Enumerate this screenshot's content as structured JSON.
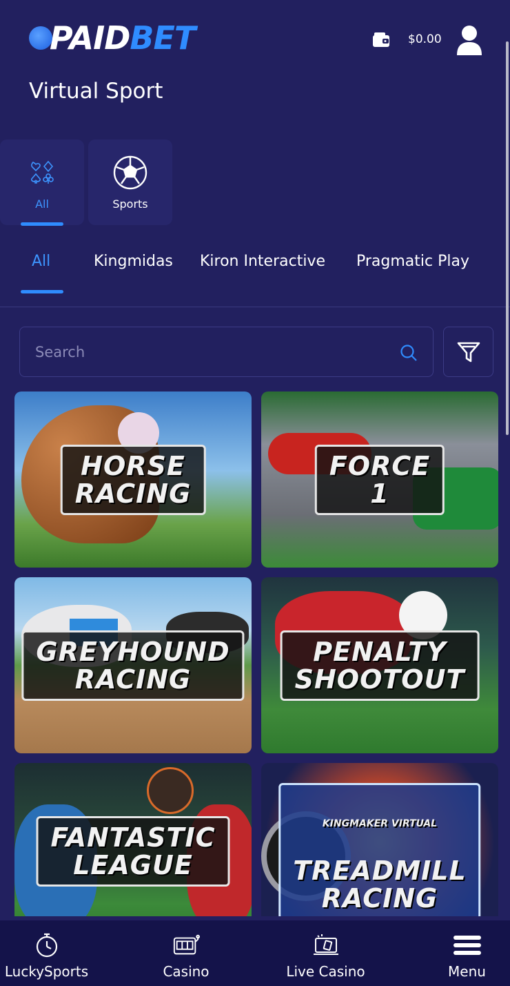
{
  "header": {
    "logo_part1": "PAID",
    "logo_part2": "BET",
    "balance": "$0.00"
  },
  "page": {
    "title": "Virtual Sport"
  },
  "categories": [
    {
      "label": "All",
      "icon": "card-suits-icon",
      "active": true
    },
    {
      "label": "Sports",
      "icon": "soccer-ball-icon",
      "active": false
    }
  ],
  "providers": [
    {
      "label": "All",
      "active": true
    },
    {
      "label": "Kingmidas",
      "active": false
    },
    {
      "label": "Kiron Interactive",
      "active": false
    },
    {
      "label": "Pragmatic Play",
      "active": false
    }
  ],
  "search": {
    "placeholder": "Search"
  },
  "games": [
    {
      "title": "HORSE\nRACING",
      "sub": ""
    },
    {
      "title": "FORCE\n1",
      "sub": ""
    },
    {
      "title": "GREYHOUND\nRACING",
      "sub": ""
    },
    {
      "title": "PENALTY\nSHOOTOUT",
      "sub": ""
    },
    {
      "title": "FANTASTIC\nLEAGUE",
      "sub": ""
    },
    {
      "title": "TREADMILL\nRACING",
      "sub": "KINGMAKER VIRTUAL"
    }
  ],
  "bottom_nav": [
    {
      "label": "LuckySports",
      "icon": "stopwatch-icon"
    },
    {
      "label": "Casino",
      "icon": "slot-machine-icon"
    },
    {
      "label": "Live Casino",
      "icon": "live-dealer-icon"
    },
    {
      "label": "Menu",
      "icon": "hamburger-menu-icon"
    }
  ],
  "colors": {
    "background": "#22205f",
    "accent": "#2f8cff",
    "bottom_nav": "#14134a"
  }
}
